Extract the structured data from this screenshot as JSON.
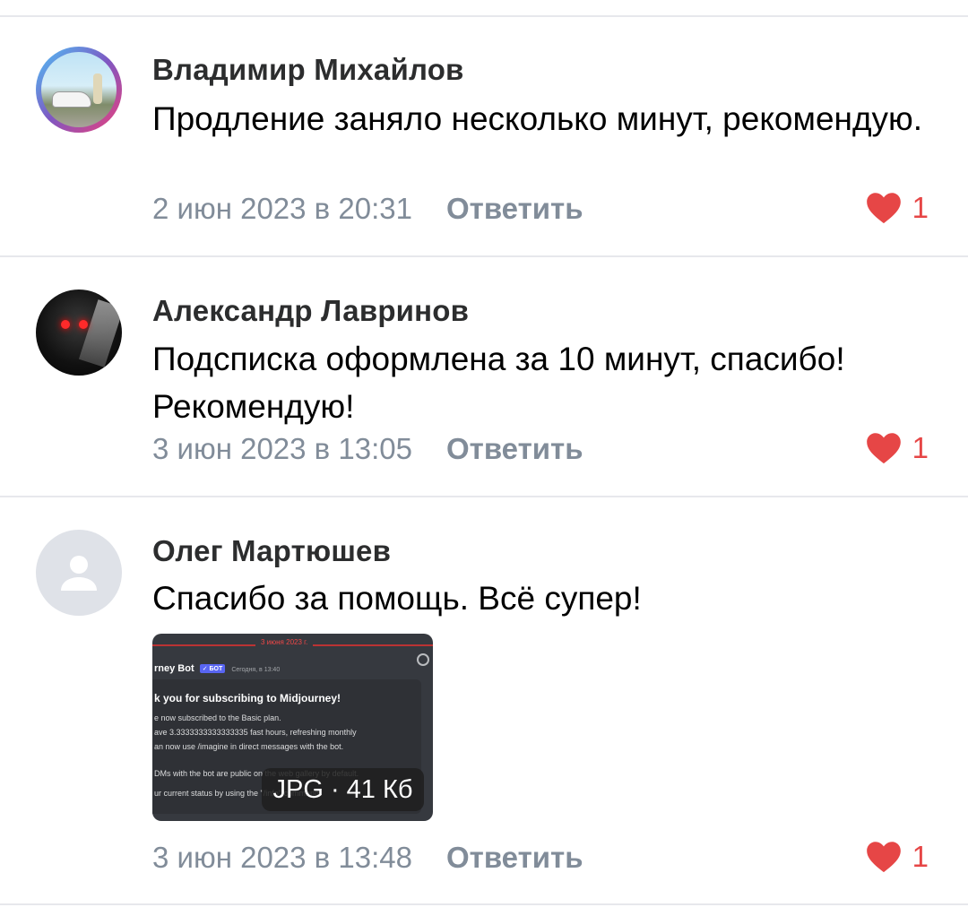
{
  "comments": [
    {
      "author": "Владимир Михайлов",
      "text": "Продление заняло несколько минут, рекомендую.",
      "date": "2 июн 2023 в 20:31",
      "reply_label": "Ответить",
      "likes": "1"
    },
    {
      "author": "Александр Лавринов",
      "text": "Подсписка оформлена за 10 минут, спасибо! Рекомендую!",
      "date": "3 июн 2023 в 13:05",
      "reply_label": "Ответить",
      "likes": "1"
    },
    {
      "author": "Олег Мартюшев",
      "text": "Спасибо за помощь. Всё супер!",
      "date": "3 июн 2023 в 13:48",
      "reply_label": "Ответить",
      "likes": "1",
      "attachment": {
        "size_label": "JPG · 41 Кб",
        "preview": {
          "date_divider": "3 июня 2023 г.",
          "bot_name": "rney Bot",
          "badge": "✓ БОТ",
          "time": "Сегодня, в 13:40",
          "heading": "k you for subscribing to Midjourney!",
          "lines": [
            "e now subscribed to the Basic plan.",
            "ave 3.3333333333333335 fast hours, refreshing monthly",
            "an now use /imagine in direct messages with the bot.",
            "DMs with the bot are public on the web gallery by default.",
            "ur current status by using the \"/info\" command"
          ]
        }
      }
    }
  ],
  "colors": {
    "like": "#e64646",
    "meta": "#818c99",
    "divider": "#e7e8ec"
  },
  "icons": {
    "like": "heart-icon",
    "placeholder_avatar": "user-silhouette-icon"
  }
}
